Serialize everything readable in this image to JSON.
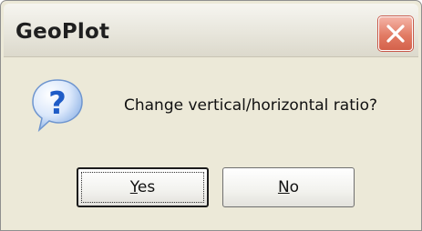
{
  "window": {
    "title": "GeoPlot"
  },
  "dialog": {
    "message": "Change vertical/horizontal ratio?",
    "icon": "question-icon"
  },
  "buttons": {
    "yes": {
      "mnemonic": "Y",
      "rest": "es"
    },
    "no": {
      "mnemonic": "N",
      "rest": "o"
    }
  },
  "colors": {
    "dialog_bg": "#ece9d8",
    "close_button": "#e27b64",
    "icon_blue": "#2f6fcf"
  }
}
